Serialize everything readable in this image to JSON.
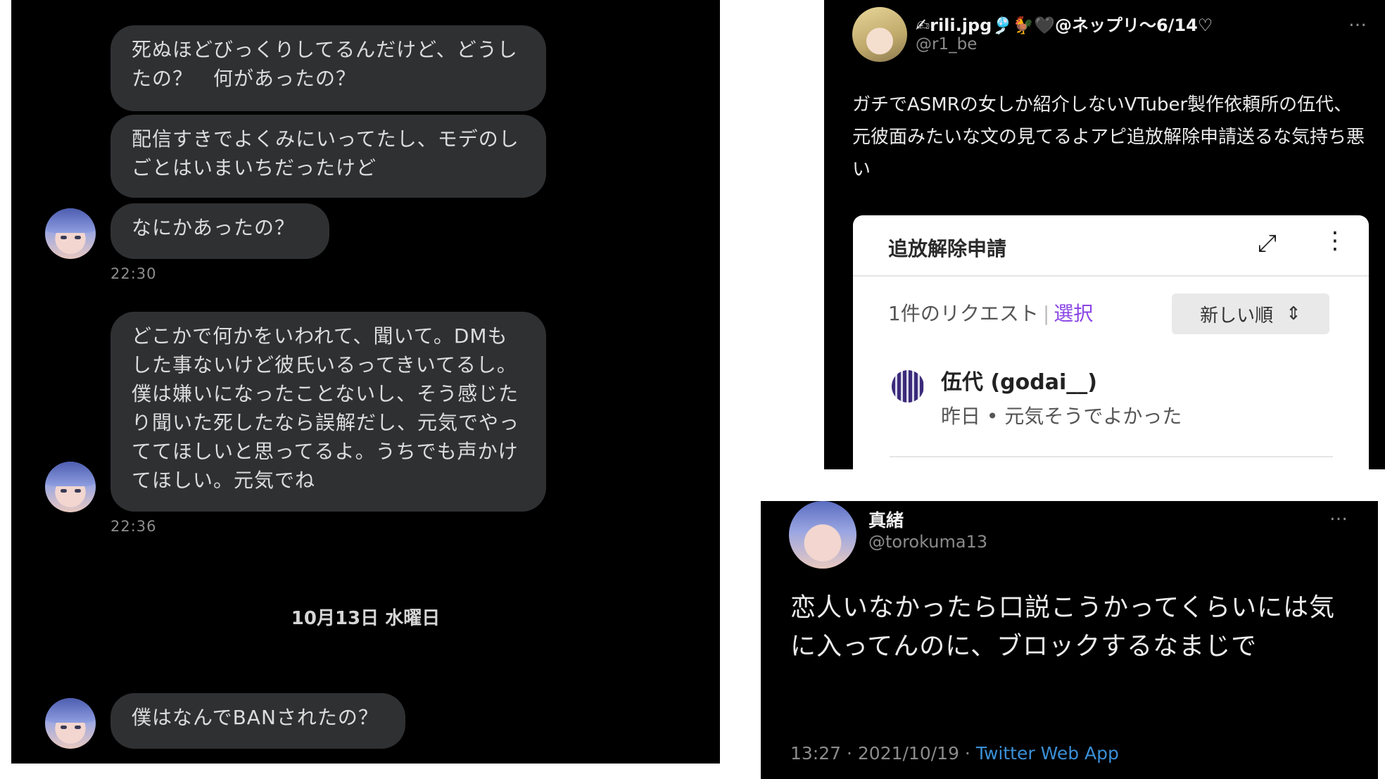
{
  "dm": {
    "messages": [
      {
        "text": "死ぬほどびっくりしてるんだけど、どうしたの？　何があったの？"
      },
      {
        "text": "配信すきでよくみにいってたし、モデのしごとはいまいちだったけど"
      },
      {
        "text": "なにかあったの？"
      },
      {
        "text": "どこかで何かをいわれて、聞いて。DMもした事ないけど彼氏いるってきいてるし。僕は嫌いになったことないし、そう感じたり聞いた死したなら誤解だし、元気でやっててほしいと思ってるよ。うちでも声かけてほしい。元気でね"
      },
      {
        "text": "僕はなんでBANされたの？"
      }
    ],
    "times": [
      "22:30",
      "22:36"
    ],
    "date_separator": "10月13日 水曜日"
  },
  "tweet_top": {
    "display_name": "✍︎rili.jpg🎐🐓🖤@ネップリ〜6/14♡",
    "handle": "@r1_be",
    "more_icon": "…",
    "body": "ガチでASMRの女しか紹介しないVTuber製作依頼所の伍代、元彼面みたいな文の見てるよアピ追放解除申請送るな気持ち悪い",
    "card": {
      "title": "追放解除申請",
      "expand_icon": "⤢",
      "kebab_icon": "⋮",
      "request_count": "1件のリクエスト",
      "pipe": "|",
      "select_label": "選択",
      "sort_label": "新しい順",
      "sort_icon": "⇕",
      "user_name": "伍代 (godai__)",
      "user_sub": "昨日 • 元気そうでよかった"
    }
  },
  "tweet_bottom": {
    "display_name": "真緒",
    "handle": "@torokuma13",
    "more_icon": "…",
    "body": "恋人いなかったら口説こうかってくらいには気に入ってんのに、ブロックするなまじで",
    "timestamp": "13:27 · 2021/10/19 · ",
    "app": "Twitter Web App"
  }
}
